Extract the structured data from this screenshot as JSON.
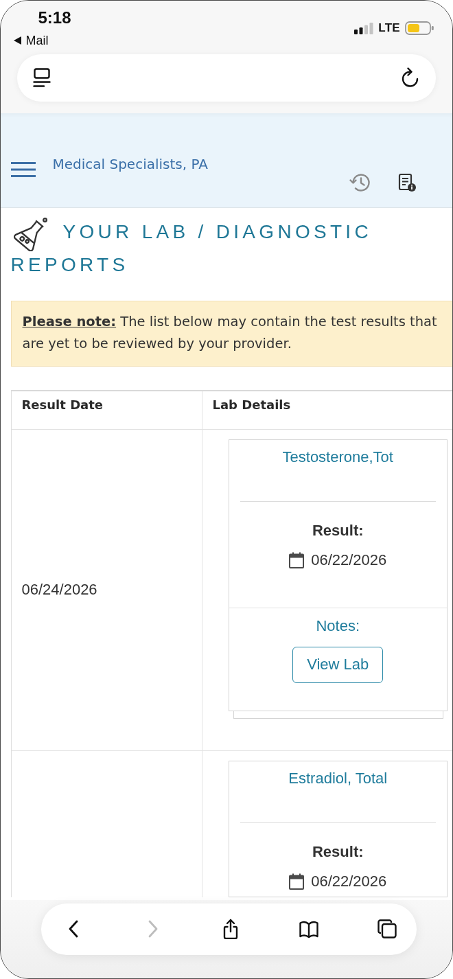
{
  "status_bar": {
    "time": "5:18",
    "back_link": "Mail",
    "network": "LTE"
  },
  "header": {
    "practice_name": "Medical Specialists, PA"
  },
  "page": {
    "title_lines": [
      "YOUR LAB / DIAGNOSTIC",
      "REPORTS"
    ],
    "notice": "**Please note:** The list below may contain the test results that are yet to be reviewed by your provider."
  },
  "results_table": {
    "columns": [
      "Result Date",
      "Lab Details"
    ],
    "rows": [
      {
        "result_date": "06/24/2026",
        "lab": {
          "name": "Testosterone,Tot",
          "result_label": "Result:",
          "result_date": "06/22/2026",
          "notes_label": "Notes:",
          "button": "View Lab"
        }
      },
      {
        "lab": {
          "name": "Estradiol, Total",
          "result_label": "Result:",
          "result_date": "06/22/2026"
        }
      }
    ]
  },
  "browser_toolbar": {
    "buttons": [
      {
        "kind": "back",
        "disabled": false
      },
      {
        "kind": "forward",
        "disabled": true
      },
      {
        "kind": "share",
        "disabled": false
      },
      {
        "kind": "bookmarks",
        "disabled": false
      },
      {
        "kind": "tabs",
        "disabled": false
      }
    ]
  }
}
